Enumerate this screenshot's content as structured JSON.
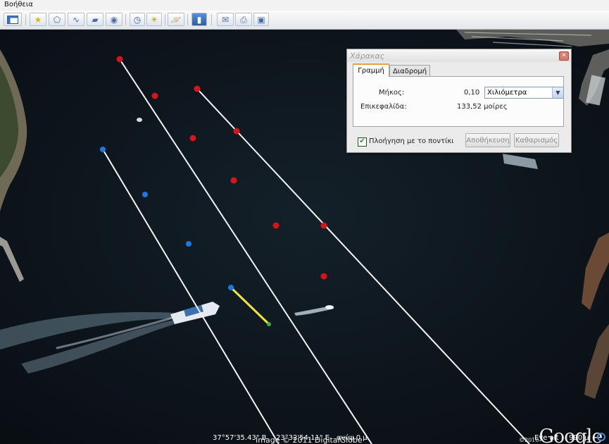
{
  "menu": {
    "help_label": "Βοήθεια"
  },
  "toolbar": {
    "buttons": [
      "sidebar",
      "add-placemark",
      "add-polygon",
      "add-path",
      "add-image-overlay",
      "record-tour",
      "historical-imagery",
      "sunlight",
      "switch-to-planets",
      "ruler",
      "email",
      "print",
      "save-image"
    ]
  },
  "ruler_dialog": {
    "title": "Χάρακας",
    "tabs": [
      "Γραμμή",
      "Διαδρομή"
    ],
    "active_tab": "Γραμμή",
    "length_label": "Μήκος:",
    "length_value": "0,10",
    "unit_selected": "Χιλιόμετρα",
    "heading_label": "Επικεφαλίδα:",
    "heading_value": "133,52 μοίρες",
    "mouse_nav_label": "Πλοήγηση με το ποντίκι",
    "mouse_nav_checked": true,
    "save_label": "Αποθήκευση",
    "clear_label": "Καθαρισμός"
  },
  "map": {
    "copyright": "Image © 2011 DigitalGlobe",
    "google_year": "©2010",
    "google_word": "Google"
  },
  "status": {
    "latitude": "37°57'35.43\" B",
    "longitude": "23°32'54.11\" E",
    "elevation": "ανύψ  0 μ",
    "eye_alt_label": "Eye alt",
    "eye_alt_value": "990 μ"
  },
  "colors": {
    "water": "#0b1218",
    "red_marker": "#d4151c",
    "blue_marker": "#1e78e0",
    "ruler_segment": "#f2e23a",
    "dialog_tab_accent": "#e8a23a"
  }
}
